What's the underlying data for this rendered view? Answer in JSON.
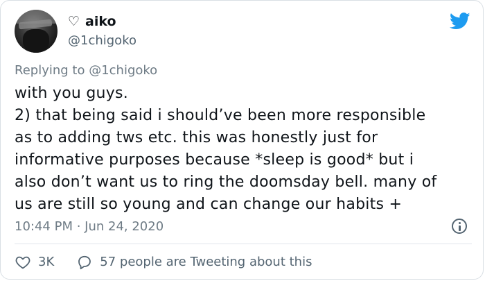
{
  "tweet": {
    "display_name": "aiko",
    "name_prefix_icon": "heart-outline-icon",
    "handle": "@1chigoko",
    "replying_to": "Replying to @1chigoko",
    "lines": [
      "with you guys.",
      "2) that being said i should’ve been more responsible",
      "as to adding tws etc. this was honestly just for",
      "informative purposes because *sleep is good* but i",
      "also don’t want us to ring the doomsday bell. many of",
      "us are still so young and can change our habits +"
    ],
    "timestamp": "10:44 PM · Jun 24, 2020",
    "likes": "3K",
    "tweeting_text": "57 people are Tweeting about this"
  },
  "colors": {
    "brand_blue": "#1d9bf0",
    "text_primary": "#0f1419",
    "text_secondary": "#536471",
    "border": "#d9dfe4"
  },
  "icons": {
    "brand": "twitter-bird-icon",
    "info": "info-icon",
    "like": "heart-outline-icon",
    "reply": "speech-bubble-icon"
  }
}
